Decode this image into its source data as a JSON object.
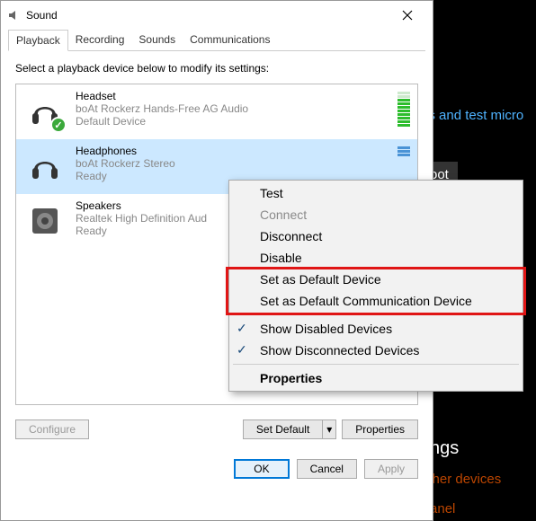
{
  "titlebar": {
    "title": "Sound"
  },
  "tabs": [
    "Playback",
    "Recording",
    "Sounds",
    "Communications"
  ],
  "active_tab": 0,
  "instruction": "Select a playback device below to modify its settings:",
  "devices": [
    {
      "name": "Headset",
      "description": "boAt Rockerz Hands-Free AG Audio",
      "status": "Default Device",
      "default": true,
      "selected": false
    },
    {
      "name": "Headphones",
      "description": "boAt Rockerz Stereo",
      "status": "Ready",
      "default": false,
      "selected": true
    },
    {
      "name": "Speakers",
      "description": "Realtek High Definition Aud",
      "status": "Ready",
      "default": false,
      "selected": false
    }
  ],
  "buttons": {
    "configure": "Configure",
    "set_default": "Set Default",
    "properties": "Properties",
    "ok": "OK",
    "cancel": "Cancel",
    "apply": "Apply"
  },
  "context_menu": {
    "test": "Test",
    "connect": "Connect",
    "disconnect": "Disconnect",
    "disable": "Disable",
    "set_default_device": "Set as Default Device",
    "set_default_comm": "Set as Default Communication Device",
    "show_disabled": "Show Disabled Devices",
    "show_disconnected": "Show Disconnected Devices",
    "properties": "Properties"
  },
  "background": {
    "link1": "es and test micro",
    "btn1": "oot",
    "heading": "tings",
    "link2": "other devices",
    "link3": "Panel"
  }
}
